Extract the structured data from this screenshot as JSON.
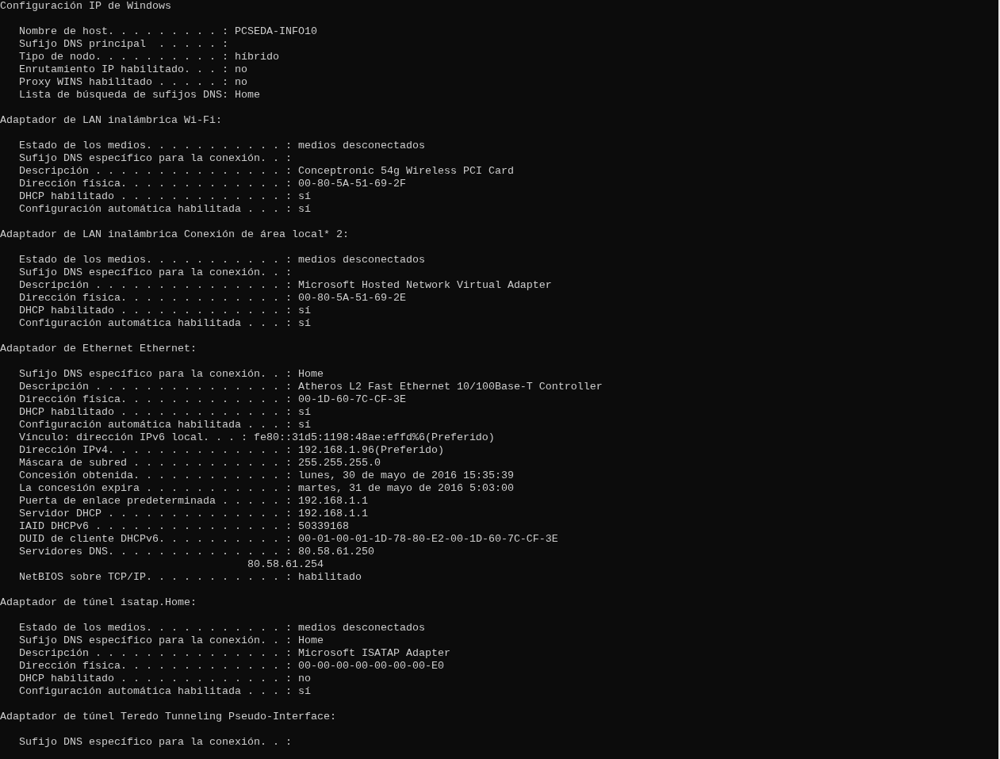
{
  "title": "Configuración IP de Windows",
  "header_fields": [
    {
      "kind": "field",
      "label": "Nombre de host. . . . . . . . . :",
      "value": "PCSEDA-INFO10"
    },
    {
      "kind": "field",
      "label": "Sufijo DNS principal  . . . . . :"
    },
    {
      "kind": "field",
      "label": "Tipo de nodo. . . . . . . . . . :",
      "value": "híbrido"
    },
    {
      "kind": "field",
      "label": "Enrutamiento IP habilitado. . . :",
      "value": "no"
    },
    {
      "kind": "field",
      "label": "Proxy WINS habilitado . . . . . :",
      "value": "no"
    },
    {
      "kind": "field",
      "label": "Lista de búsqueda de sufijos DNS:",
      "value": "Home"
    }
  ],
  "sections": [
    {
      "heading": "Adaptador de LAN inalámbrica Wi-Fi:",
      "fields": [
        {
          "kind": "field",
          "label": "Estado de los medios. . . . . . . . . . . :",
          "value": "medios desconectados"
        },
        {
          "kind": "field",
          "label": "Sufijo DNS específico para la conexión. . :"
        },
        {
          "kind": "field",
          "label": "Descripción . . . . . . . . . . . . . . . :",
          "value": "Conceptronic 54g Wireless PCI Card"
        },
        {
          "kind": "field",
          "label": "Dirección física. . . . . . . . . . . . . :",
          "value": "00-80-5A-51-69-2F"
        },
        {
          "kind": "field",
          "label": "DHCP habilitado . . . . . . . . . . . . . :",
          "value": "sí"
        },
        {
          "kind": "field",
          "label": "Configuración automática habilitada . . . :",
          "value": "sí"
        }
      ]
    },
    {
      "heading": "Adaptador de LAN inalámbrica Conexión de área local* 2:",
      "fields": [
        {
          "kind": "field",
          "label": "Estado de los medios. . . . . . . . . . . :",
          "value": "medios desconectados"
        },
        {
          "kind": "field",
          "label": "Sufijo DNS específico para la conexión. . :"
        },
        {
          "kind": "field",
          "label": "Descripción . . . . . . . . . . . . . . . :",
          "value": "Microsoft Hosted Network Virtual Adapter"
        },
        {
          "kind": "field",
          "label": "Dirección física. . . . . . . . . . . . . :",
          "value": "00-80-5A-51-69-2E"
        },
        {
          "kind": "field",
          "label": "DHCP habilitado . . . . . . . . . . . . . :",
          "value": "sí"
        },
        {
          "kind": "field",
          "label": "Configuración automática habilitada . . . :",
          "value": "sí"
        }
      ]
    },
    {
      "heading": "Adaptador de Ethernet Ethernet:",
      "fields": [
        {
          "kind": "field",
          "label": "Sufijo DNS específico para la conexión. . :",
          "value": "Home"
        },
        {
          "kind": "field",
          "label": "Descripción . . . . . . . . . . . . . . . :",
          "value": "Atheros L2 Fast Ethernet 10/100Base-T Controller"
        },
        {
          "kind": "field",
          "label": "Dirección física. . . . . . . . . . . . . :",
          "value": "00-1D-60-7C-CF-3E"
        },
        {
          "kind": "field",
          "label": "DHCP habilitado . . . . . . . . . . . . . :",
          "value": "sí"
        },
        {
          "kind": "field",
          "label": "Configuración automática habilitada . . . :",
          "value": "sí"
        },
        {
          "kind": "field",
          "label": "Vínculo: dirección IPv6 local. . . :",
          "value": "fe80::31d5:1198:48ae:effd%6(Preferido)"
        },
        {
          "kind": "field",
          "label": "Dirección IPv4. . . . . . . . . . . . . . :",
          "value": "192.168.1.96(Preferido)"
        },
        {
          "kind": "field",
          "label": "Máscara de subred . . . . . . . . . . . . :",
          "value": "255.255.255.0"
        },
        {
          "kind": "field",
          "label": "Concesión obtenida. . . . . . . . . . . . :",
          "value": "lunes, 30 de mayo de 2016 15:35:39"
        },
        {
          "kind": "field",
          "label": "La concesión expira . . . . . . . . . . . :",
          "value": "martes, 31 de mayo de 2016 5:03:00"
        },
        {
          "kind": "field",
          "label": "Puerta de enlace predeterminada . . . . . :",
          "value": "192.168.1.1"
        },
        {
          "kind": "field",
          "label": "Servidor DHCP . . . . . . . . . . . . . . :",
          "value": "192.168.1.1"
        },
        {
          "kind": "field",
          "label": "IAID DHCPv6 . . . . . . . . . . . . . . . :",
          "value": "50339168"
        },
        {
          "kind": "field",
          "label": "DUID de cliente DHCPv6. . . . . . . . . . :",
          "value": "00-01-00-01-1D-78-80-E2-00-1D-60-7C-CF-3E"
        },
        {
          "kind": "field",
          "label": "Servidores DNS. . . . . . . . . . . . . . :",
          "value": "80.58.61.250"
        },
        {
          "kind": "continuation",
          "value": "80.58.61.254"
        },
        {
          "kind": "field",
          "label": "NetBIOS sobre TCP/IP. . . . . . . . . . . :",
          "value": "habilitado"
        }
      ]
    },
    {
      "heading": "Adaptador de túnel isatap.Home:",
      "fields": [
        {
          "kind": "field",
          "label": "Estado de los medios. . . . . . . . . . . :",
          "value": "medios desconectados"
        },
        {
          "kind": "field",
          "label": "Sufijo DNS específico para la conexión. . :",
          "value": "Home"
        },
        {
          "kind": "field",
          "label": "Descripción . . . . . . . . . . . . . . . :",
          "value": "Microsoft ISATAP Adapter"
        },
        {
          "kind": "field",
          "label": "Dirección física. . . . . . . . . . . . . :",
          "value": "00-00-00-00-00-00-00-E0"
        },
        {
          "kind": "field",
          "label": "DHCP habilitado . . . . . . . . . . . . . :",
          "value": "no"
        },
        {
          "kind": "field",
          "label": "Configuración automática habilitada . . . :",
          "value": "sí"
        }
      ]
    },
    {
      "heading": "Adaptador de túnel Teredo Tunneling Pseudo-Interface:",
      "fields": [
        {
          "kind": "field",
          "label": "Sufijo DNS específico para la conexión. . :"
        }
      ]
    }
  ]
}
